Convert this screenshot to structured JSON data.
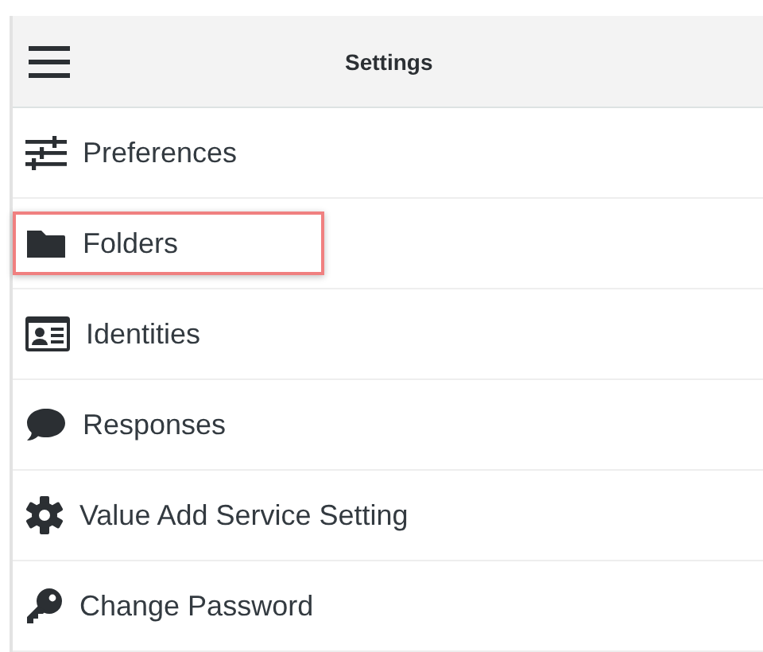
{
  "header": {
    "title": "Settings"
  },
  "items": [
    {
      "label": "Preferences",
      "highlighted": false
    },
    {
      "label": "Folders",
      "highlighted": true
    },
    {
      "label": "Identities",
      "highlighted": false
    },
    {
      "label": "Responses",
      "highlighted": false
    },
    {
      "label": "Value Add Service Setting",
      "highlighted": false
    },
    {
      "label": "Change Password",
      "highlighted": false
    }
  ]
}
